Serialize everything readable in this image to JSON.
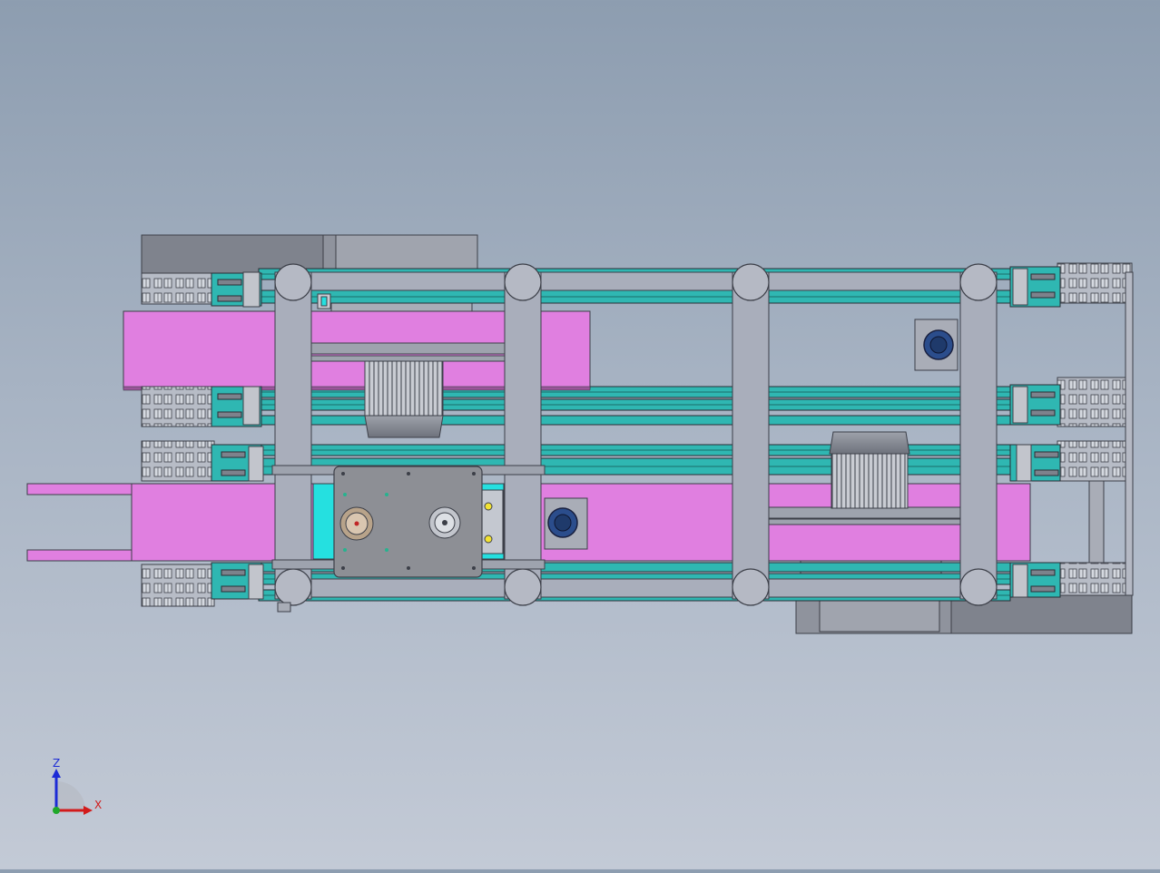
{
  "triad": {
    "z_label": "Z",
    "x_label": "X"
  },
  "colors": {
    "background_top": "#8d9db0",
    "background_bottom": "#c3cad6",
    "frame_grey": "#a9aebb",
    "frame_edge": "#3c3f48",
    "rail_teal": "#2fb7b2",
    "conveyor_magenta": "#e07fe0",
    "plate_grey": "#8d8f95",
    "cyan_block": "#25e0e0",
    "motor_blue": "#2b4d8c",
    "axis_z": "#1c2bd6",
    "axis_x": "#d21b1b",
    "axis_y": "#1fa82a"
  },
  "model_view": {
    "view": "top",
    "components": [
      "frame",
      "cross-beams",
      "chain-rails",
      "belt-conveyors",
      "gearbox",
      "motors",
      "corner-gussets",
      "chain-guides"
    ]
  }
}
